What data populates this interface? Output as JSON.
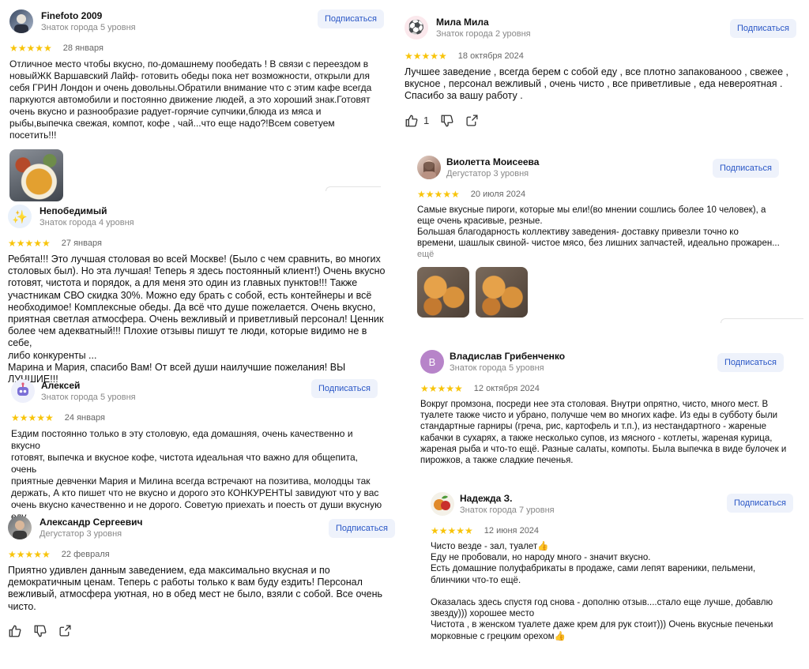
{
  "subscribe_label": "Подписаться",
  "colors": {
    "star": "#f8c40a",
    "subscribe_bg": "#eef2fb",
    "subscribe_text": "#2a57c6",
    "avatar_v": "#b784c9"
  },
  "reviews": [
    {
      "author": "Finefoto 2009",
      "level": "Знаток города 5 уровня",
      "stars": "★★★★★",
      "date": "28 января",
      "text": "Отличное место чтобы вкусно, по-домашнему пообедать ! В связи с переездом в\nновыйЖК Варшавский Лайф- готовить обеды пока нет возможности, открыли для\nсебя ГРИН Лондон и очень довольны.Обратили внимание что с этим кафе всегда\nпаркуются автомобили и постоянно движение людей, а это хороший знак.Готовят\nочень вкусно и разнообразие радует-горячие супчики,блюда из мяса и\nрыбы,выпечка свежая, компот, кофе , чай...что еще надо?!Всем советуем посетить!!!",
      "avatar_icon": "photo-avatar-icon"
    },
    {
      "author": "Непобедимый",
      "level": "Знаток города 4 уровня",
      "stars": "★★★★★",
      "date": "27 января",
      "text": "Ребята!!! Это лучшая столовая во всей Москве! (Было с чем сравнить, во многих\nстоловых был). Но эта лучшая! Теперь я здесь постоянный клиент!) Очень вкусно\nготовят, чистота и порядок, а для меня это один из главных пунктов!!! Также\nучастникам СВО скидка 30%. Можно еду брать с собой, есть контейнеры и всё\nнеобходимое! Комплексные обеды. Да всё что душе пожелается. Очень вкусно,\nприятная светлая атмосфера. Очень вежливый и приветливый персонал! Ценник\nболее чем адекватный!!! Плохие отзывы пишут те люди, которые видимо не в себе,\nлибо конкуренты ...\nМарина и Мария, спасибо Вам! От всей души наилучшие пожелания! ВЫ ЛУЧШИЕ!!!",
      "avatar_glyph": "✨",
      "avatar_icon": "sparkle-avatar-icon"
    },
    {
      "author": "Алексей",
      "level": "Знаток города 5 уровня",
      "stars": "★★★★★",
      "date": "24 января",
      "text": "Ездим постоянно только в эту столовую, еда домашняя, очень качественно и вкусно\nготовят, выпечка и вкусное кофе, чистота идеальная что важно для общепита, очень\nприятные девченки Мария и Милина всегда встречают на позитива, молодцы так\nдержать, А кто пишет что не вкусно и дорого это КОНКУРЕНТЫ завидуют что у вас\nочень вкусно качественно и не дорого. Советую приехать и поесть от души вкусную\nеду.",
      "avatar_icon": "robot-avatar-icon"
    },
    {
      "author": "Александр Сергеевич",
      "level": "Дегустатор 3 уровня",
      "stars": "★★★★★",
      "date": "22 февраля",
      "text": "Приятно удивлен данным заведением, еда максимально вкусная и по\nдемократичным ценам. Теперь с работы только к вам буду ездить! Персонал\nвежливый, атмосфера уютная, но в обед мест не было, взяли с собой. Все очень\nчисто.",
      "avatar_icon": "photo-avatar-icon"
    },
    {
      "author": "Мила Мила",
      "level": "Знаток города 2 уровня",
      "stars": "★★★★★",
      "date": "18 октября 2024",
      "text": "Лучшее заведение , всегда берем с собой еду , все плотно запакованооо , свежее ,\nвкусное , персонал вежливый , очень чисто , все приветливые , еда невероятная .\nСпасибо за вашу работу .",
      "like_count": "1",
      "avatar_glyph": "⚽",
      "avatar_icon": "soccer-ball-avatar-icon"
    },
    {
      "author": "Виолетта Моисеева",
      "level": "Дегустатор 3 уровня",
      "stars": "★★★★★",
      "date": "20 июля 2024",
      "text": "Самые вкусные пироги, которые мы ели!(во мнении сошлись более 10 человек), а\nеще очень красивые, резные.\nБольшая благодарность коллективу заведения- доставку привезли точно ко\nвремени, шашлык свиной- чистое мясо, без лишних запчастей, идеально прожарен...",
      "more": "ещё",
      "avatar_icon": "photo-avatar-icon"
    },
    {
      "author": "Владислав Грибенченко",
      "level": "Знаток города 5 уровня",
      "stars": "★★★★★",
      "date": "12 октября 2024",
      "text": "Вокруг промзона, посреди нее эта столовая. Внутри опрятно, чисто, много мест. В\nтуалете также чисто и убрано, получше чем во многих кафе. Из еды в субботу были\nстандартные гарниры (греча, рис, картофель и т.п.), из нестандартного - жареные\nкабачки в сухарях, а также несколько супов, из мясного - котлеты, жареная курица,\nжареная рыба и что-то ещё. Разные салаты, компоты. Была выпечка в виде булочек и\nпирожков, а также сладкие печенья.",
      "avatar_letter": "В",
      "avatar_icon": "letter-avatar-icon"
    },
    {
      "author": "Надежда З.",
      "level": "Знаток города 7 уровня",
      "stars": "★★★★★",
      "date": "12 июня 2024",
      "text": "Чисто везде - зал, туалет👍\nЕду не пробовали, но народу много - значит вкусно.\nЕсть домашние полуфабрикаты в продаже, сами лепят вареники, пельмени,\nблинчики что-то ещё.\n\nОказалась здесь спустя год снова - дополню отзыв....стало еще лучше, добавлю\nзвезду))) хорошее место\nЧистота , в женском туалете даже крем для рук стоит))) Очень вкусные печеньки\nморковные с грецким орехом👍",
      "avatar_icon": "fruit-avatar-icon"
    }
  ]
}
